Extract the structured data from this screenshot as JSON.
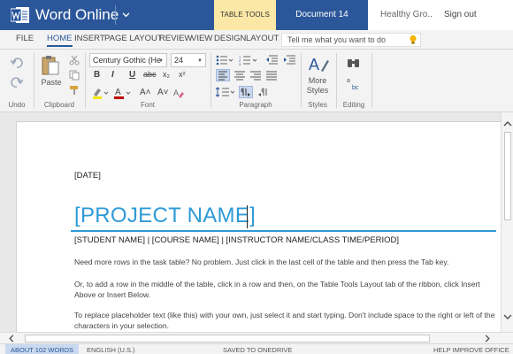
{
  "titlebar": {
    "app_name": "Word Online",
    "contextual_tab": "TABLE TOOLS",
    "document_name": "Document 14",
    "account_name": "Healthy Gro...",
    "sign_out": "Sign out",
    "brand_color": "#2b579a",
    "contextual_color": "#fbe8a6"
  },
  "tabs": {
    "file": "FILE",
    "home": "HOME",
    "insert": "INSERT",
    "page_layout": "PAGE LAYOUT",
    "review": "REVIEW",
    "view": "VIEW",
    "design": "DESIGN",
    "layout": "LAYOUT",
    "active": "HOME",
    "tell_me_placeholder": "Tell me what you want to do"
  },
  "ribbon": {
    "undo_group": "Undo",
    "clipboard_group": "Clipboard",
    "paste_label": "Paste",
    "font_group": "Font",
    "font_name": "Century Gothic (He",
    "font_size": "24",
    "bold": "B",
    "italic": "I",
    "underline": "U",
    "strike": "abc",
    "subscript": "x₂",
    "superscript": "x²",
    "grow_font": "A˄",
    "shrink_font": "A˅",
    "paragraph_group": "Paragraph",
    "styles_group": "Styles",
    "styles_label_1": "More",
    "styles_label_2": "Styles",
    "editing_group": "Editing"
  },
  "document": {
    "date": "[DATE]",
    "title": "[PROJECT NAME]",
    "subtitle": "[STUDENT NAME] | [COURSE NAME] | [INSTRUCTOR NAME/CLASS TIME/PERIOD]",
    "p1": "Need more rows in the task table? No problem. Just click in the last cell of the table and then press the Tab key.",
    "p2": "Or, to add a row in the middle of the table, click in a row and then, on the Table Tools Layout tab of the ribbon, click Insert Above or Insert Below.",
    "p3": "To replace placeholder text (like this) with your own, just select it and start typing. Don't include space to the right or left of the characters in your selection.",
    "title_color": "#2e9ad6"
  },
  "status": {
    "word_count": "ABOUT 102 WORDS",
    "language": "ENGLISH (U.S.)",
    "save_state": "SAVED TO ONEDRIVE",
    "help": "HELP IMPROVE OFFICE"
  }
}
